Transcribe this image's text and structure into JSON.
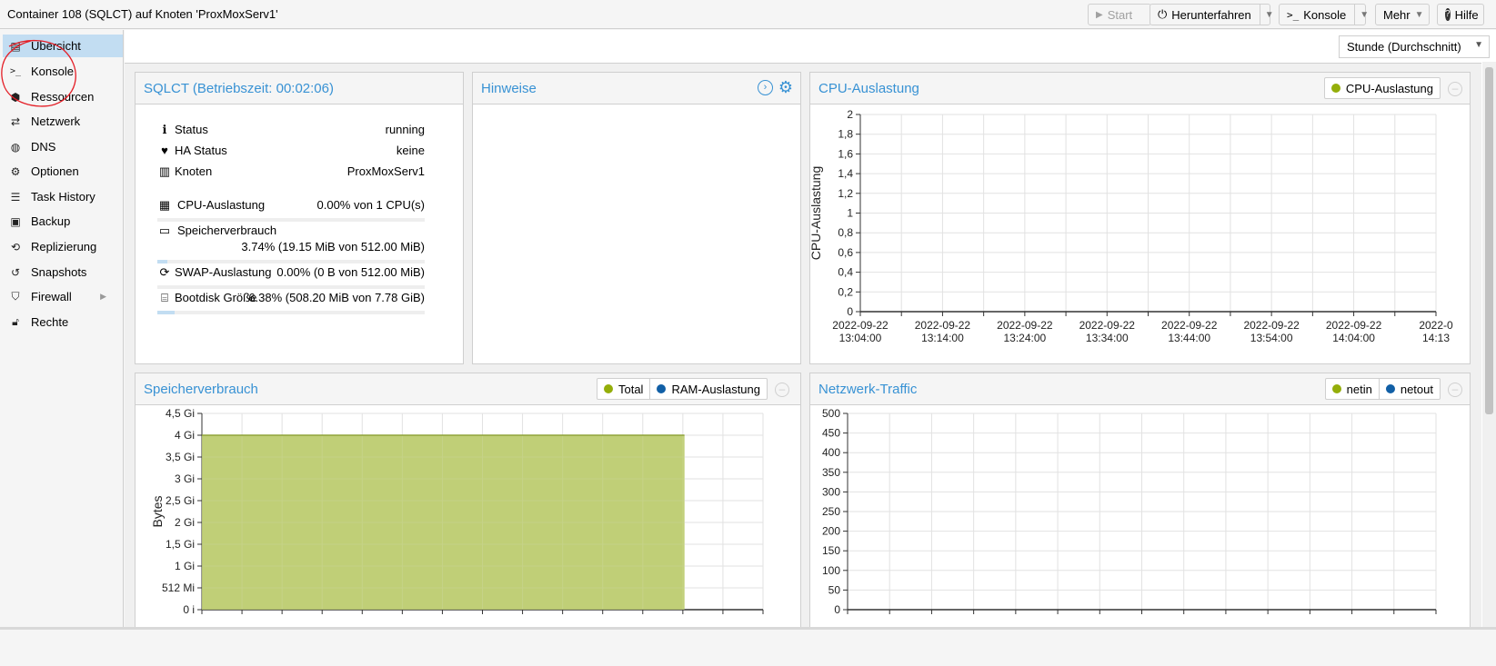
{
  "header": {
    "title": "Container 108 (SQLCT) auf Knoten 'ProxMoxServ1'",
    "buttons": {
      "start": "Start",
      "shutdown": "Herunterfahren",
      "console": "Konsole",
      "more": "Mehr",
      "help": "Hilfe"
    }
  },
  "sidebar": {
    "items": [
      {
        "label": "Übersicht",
        "icon": "book-icon"
      },
      {
        "label": "Konsole",
        "icon": "terminal-icon"
      },
      {
        "label": "Ressourcen",
        "icon": "cube-icon"
      },
      {
        "label": "Netzwerk",
        "icon": "exchange-icon"
      },
      {
        "label": "DNS",
        "icon": "globe-icon"
      },
      {
        "label": "Optionen",
        "icon": "gear-icon"
      },
      {
        "label": "Task History",
        "icon": "list-icon"
      },
      {
        "label": "Backup",
        "icon": "floppy-icon"
      },
      {
        "label": "Replizierung",
        "icon": "retweet-icon"
      },
      {
        "label": "Snapshots",
        "icon": "history-icon"
      },
      {
        "label": "Firewall",
        "icon": "shield-icon"
      },
      {
        "label": "Rechte",
        "icon": "unlock-icon"
      }
    ]
  },
  "timeframe": {
    "value": "Stunde (Durchschnitt)"
  },
  "status_panel": {
    "title": "SQLCT (Betriebszeit: 00:02:06)",
    "rows": {
      "status": {
        "label": "Status",
        "value": "running"
      },
      "ha": {
        "label": "HA Status",
        "value": "keine"
      },
      "node": {
        "label": "Knoten",
        "value": "ProxMoxServ1"
      },
      "cpu": {
        "label": "CPU-Auslastung",
        "value": "0.00% von 1 CPU(s)",
        "fraction": 0.0
      },
      "mem": {
        "label": "Speicherverbrauch",
        "value": "3.74% (19.15 MiB von 512.00 MiB)",
        "fraction": 0.0374
      },
      "swap": {
        "label": "SWAP-Auslastung",
        "value": "0.00% (0 B von 512.00 MiB)",
        "fraction": 0.0
      },
      "disk": {
        "label": "Bootdisk Größe",
        "value": "6.38% (508.20 MiB von 7.78 GiB)",
        "fraction": 0.0638
      }
    }
  },
  "notes_panel": {
    "title": "Hinweise"
  },
  "cpu_panel": {
    "title": "CPU-Auslastung",
    "legend": [
      "CPU-Auslastung"
    ]
  },
  "mem_panel": {
    "title": "Speicherverbrauch",
    "legend": [
      "Total",
      "RAM-Auslastung"
    ]
  },
  "net_panel": {
    "title": "Netzwerk-Traffic",
    "legend": [
      "netin",
      "netout"
    ]
  },
  "colors": {
    "accent": "#3892d4",
    "selected": "#c2ddf2",
    "total_green": "#94ae0a",
    "ram_blue": "#115fa6",
    "mem_fill": "#c0cf77"
  },
  "chart_data": [
    {
      "type": "line",
      "ylabel": "CPU-Auslastung",
      "ylim": [
        0,
        2
      ],
      "yticks": [
        "0",
        "0,2",
        "0,4",
        "0,6",
        "0,8",
        "1",
        "1,2",
        "1,4",
        "1,6",
        "1,8",
        "2"
      ],
      "xticks": [
        [
          "2022-09-22",
          "13:04:00"
        ],
        [
          "2022-09-22",
          "13:14:00"
        ],
        [
          "2022-09-22",
          "13:24:00"
        ],
        [
          "2022-09-22",
          "13:34:00"
        ],
        [
          "2022-09-22",
          "13:44:00"
        ],
        [
          "2022-09-22",
          "13:54:00"
        ],
        [
          "2022-09-22",
          "14:04:00"
        ],
        [
          "2022-0",
          "14:13"
        ]
      ],
      "series": [
        {
          "name": "CPU-Auslastung",
          "values": []
        }
      ],
      "grid": true
    },
    {
      "type": "area",
      "ylabel": "Bytes",
      "yticks": [
        "0 i",
        "512 Mi",
        "1 Gi",
        "1,5 Gi",
        "2 Gi",
        "2,5 Gi",
        "3 Gi",
        "3,5 Gi",
        "4 Gi",
        "4,5 Gi"
      ],
      "ylim": [
        0,
        4.5
      ],
      "series": [
        {
          "name": "Total",
          "values": [
            4,
            4,
            4,
            4,
            4,
            4,
            4,
            4,
            4,
            4,
            4,
            4,
            4
          ],
          "x_end_fraction": 0.86
        }
      ],
      "grid": true
    },
    {
      "type": "line",
      "ylabel": "",
      "ylim": [
        0,
        500
      ],
      "yticks": [
        "0",
        "50",
        "100",
        "150",
        "200",
        "250",
        "300",
        "350",
        "400",
        "450",
        "500"
      ],
      "series": [
        {
          "name": "netin",
          "values": []
        },
        {
          "name": "netout",
          "values": []
        }
      ],
      "grid": true
    }
  ]
}
